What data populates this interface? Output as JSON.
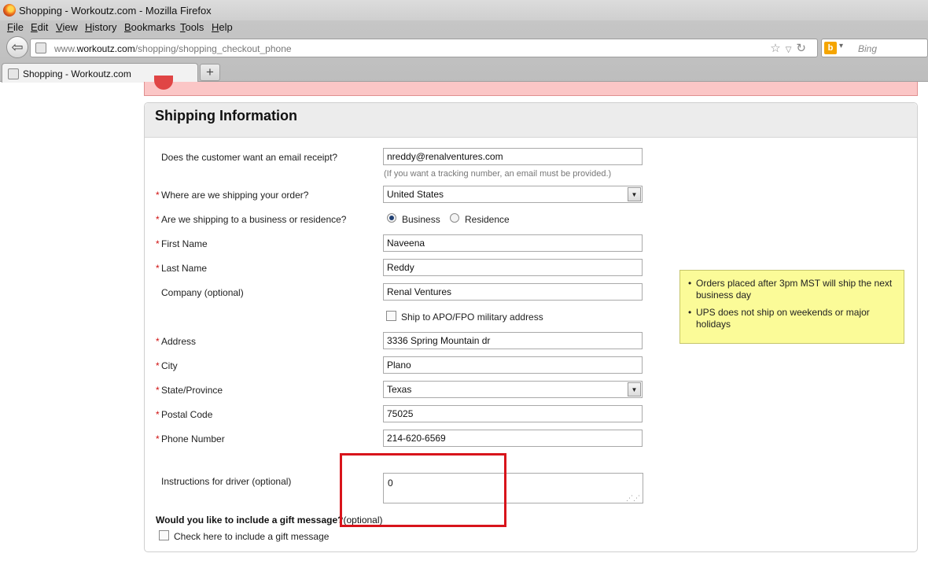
{
  "window": {
    "title": "Shopping - Workoutz.com - Mozilla Firefox"
  },
  "menu": [
    "File",
    "Edit",
    "View",
    "History",
    "Bookmarks",
    "Tools",
    "Help"
  ],
  "navbar": {
    "url_prefix": "www.",
    "url_domain": "workoutz.com",
    "url_path": "/shopping/shopping_checkout_phone",
    "search_placeholder": "Bing"
  },
  "tab": {
    "label": "Shopping - Workoutz.com",
    "new_tab": "+"
  },
  "form": {
    "title": "Shipping Information",
    "required_mark": "*",
    "email_receipt": {
      "label": "Does the customer want an email receipt?",
      "value": "nreddy@renalventures.com",
      "hint": "(If you want a tracking number, an email must be provided.)"
    },
    "country": {
      "label": "Where are we shipping your order?",
      "value": "United States"
    },
    "address_type": {
      "label": "Are we shipping to a business or residence?",
      "options": [
        "Business",
        "Residence"
      ],
      "selected": "Business"
    },
    "first_name": {
      "label": "First Name",
      "value": "Naveena"
    },
    "last_name": {
      "label": "Last Name",
      "value": "Reddy"
    },
    "company": {
      "label": "Company (optional)",
      "value": "Renal Ventures"
    },
    "military": {
      "label": "Ship to APO/FPO military address",
      "checked": false
    },
    "address": {
      "label": "Address",
      "value": "3336 Spring Mountain dr"
    },
    "city": {
      "label": "City",
      "value": "Plano"
    },
    "state": {
      "label": "State/Province",
      "value": "Texas"
    },
    "postal": {
      "label": "Postal Code",
      "value": "75025"
    },
    "phone": {
      "label": "Phone Number",
      "value": "214-620-6569"
    },
    "instructions": {
      "label": "Instructions for driver (optional)",
      "value": "0"
    },
    "gift": {
      "question": "Would you like to include a gift message?",
      "optional": "(optional)",
      "checkbox_label": "Check here to include a gift message",
      "checked": false
    }
  },
  "info_box": {
    "items": [
      "Orders placed after 3pm MST will ship the next business day",
      "UPS does not ship on weekends or major holidays"
    ]
  },
  "colors": {
    "required": "#d01010",
    "highlight": "#d8141b",
    "info_bg": "#fbfb98",
    "error_bg": "#fbc6c6"
  }
}
